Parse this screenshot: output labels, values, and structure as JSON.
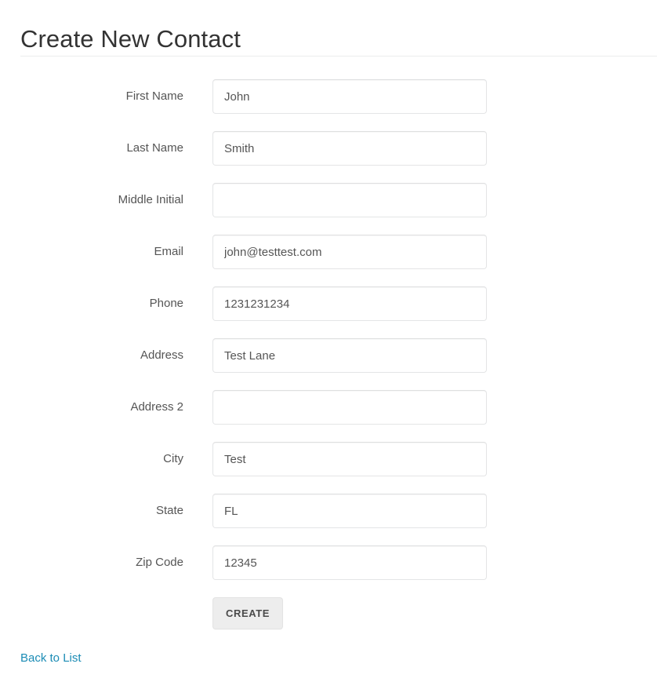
{
  "page": {
    "title": "Create New Contact"
  },
  "form": {
    "fields": [
      {
        "label": "First Name",
        "value": "John",
        "placeholder": "",
        "name": "first-name"
      },
      {
        "label": "Last Name",
        "value": "Smith",
        "placeholder": "",
        "name": "last-name"
      },
      {
        "label": "Middle Initial",
        "value": "",
        "placeholder": "",
        "name": "middle-initial"
      },
      {
        "label": "Email",
        "value": "john@testtest.com",
        "placeholder": "",
        "name": "email"
      },
      {
        "label": "Phone",
        "value": "1231231234",
        "placeholder": "",
        "name": "phone"
      },
      {
        "label": "Address",
        "value": "Test Lane",
        "placeholder": "",
        "name": "address"
      },
      {
        "label": "Address 2",
        "value": "",
        "placeholder": "",
        "name": "address-2"
      },
      {
        "label": "City",
        "value": "Test",
        "placeholder": "",
        "name": "city"
      },
      {
        "label": "State",
        "value": "FL",
        "placeholder": "",
        "name": "state"
      },
      {
        "label": "Zip Code",
        "value": "12345",
        "placeholder": "",
        "name": "zip-code"
      }
    ],
    "submit_label": "CREATE"
  },
  "footer": {
    "back_link_label": "Back to List"
  },
  "colors": {
    "link": "#1c8cb5",
    "title_text": "#333333",
    "label_text": "#555555",
    "input_border": "#e4e5e6",
    "button_bg": "#ededed",
    "button_text": "#4a4a4a",
    "divider": "#eceded"
  }
}
